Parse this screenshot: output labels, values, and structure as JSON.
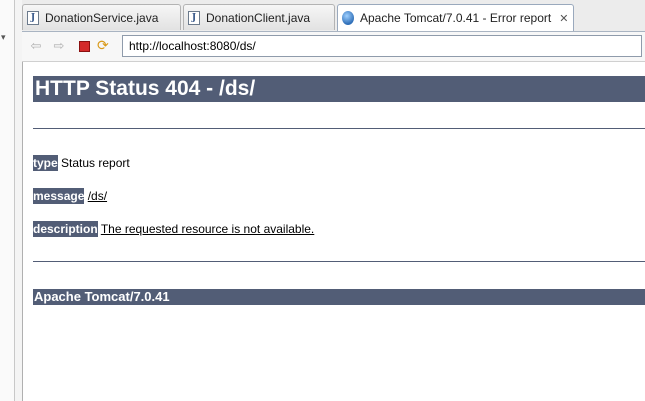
{
  "tabs": [
    {
      "label": "DonationService.java",
      "icon": "java-file-icon"
    },
    {
      "label": "DonationClient.java",
      "icon": "java-file-icon"
    },
    {
      "label": "Apache Tomcat/7.0.41 - Error report",
      "icon": "globe-icon",
      "close": "✕"
    }
  ],
  "toolbar": {
    "url": "http://localhost:8080/ds/"
  },
  "page": {
    "heading": "HTTP Status 404 - /ds/",
    "type_label": "type",
    "type_value": "Status report",
    "message_label": "message",
    "message_value": "/ds/",
    "description_label": "description",
    "description_value": "The requested resource is not available.",
    "footer": "Apache Tomcat/7.0.41"
  },
  "colors": {
    "header_band": "#525d76",
    "stop": "#d42a2a"
  }
}
